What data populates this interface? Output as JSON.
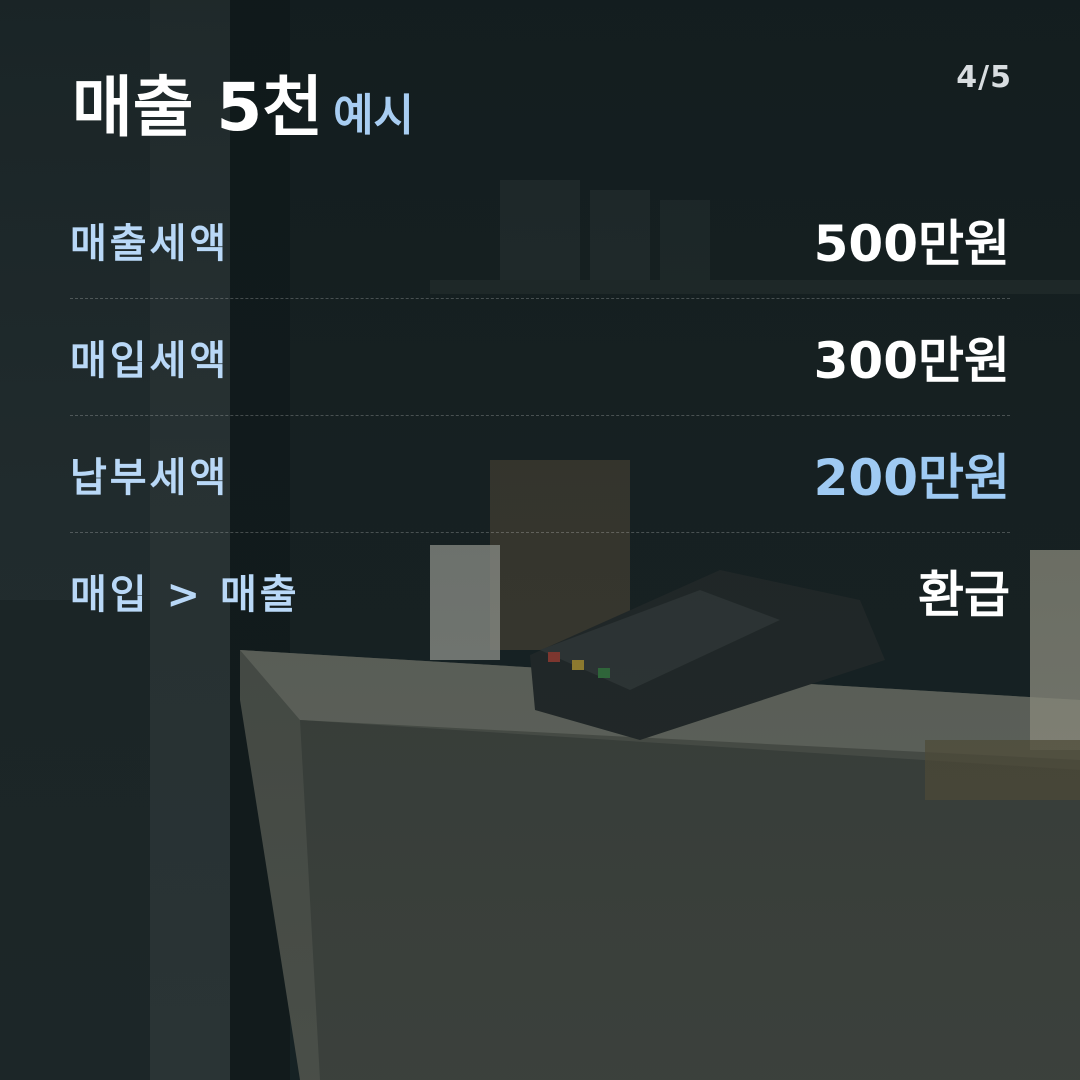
{
  "page_indicator": "4/5",
  "title": {
    "main": "매출 5천",
    "sub": "예시"
  },
  "rows": [
    {
      "label": "매출세액",
      "value": "500만원"
    },
    {
      "label": "매입세액",
      "value": "300만원"
    },
    {
      "label": "납부세액",
      "value": "200만원"
    },
    {
      "label": "매입 > 매출",
      "value": "환급"
    }
  ],
  "colors": {
    "label": "#b9d8f7",
    "value": "#ffffff",
    "accent_value": "#9fcaf3",
    "background": "#0f1a1c"
  }
}
